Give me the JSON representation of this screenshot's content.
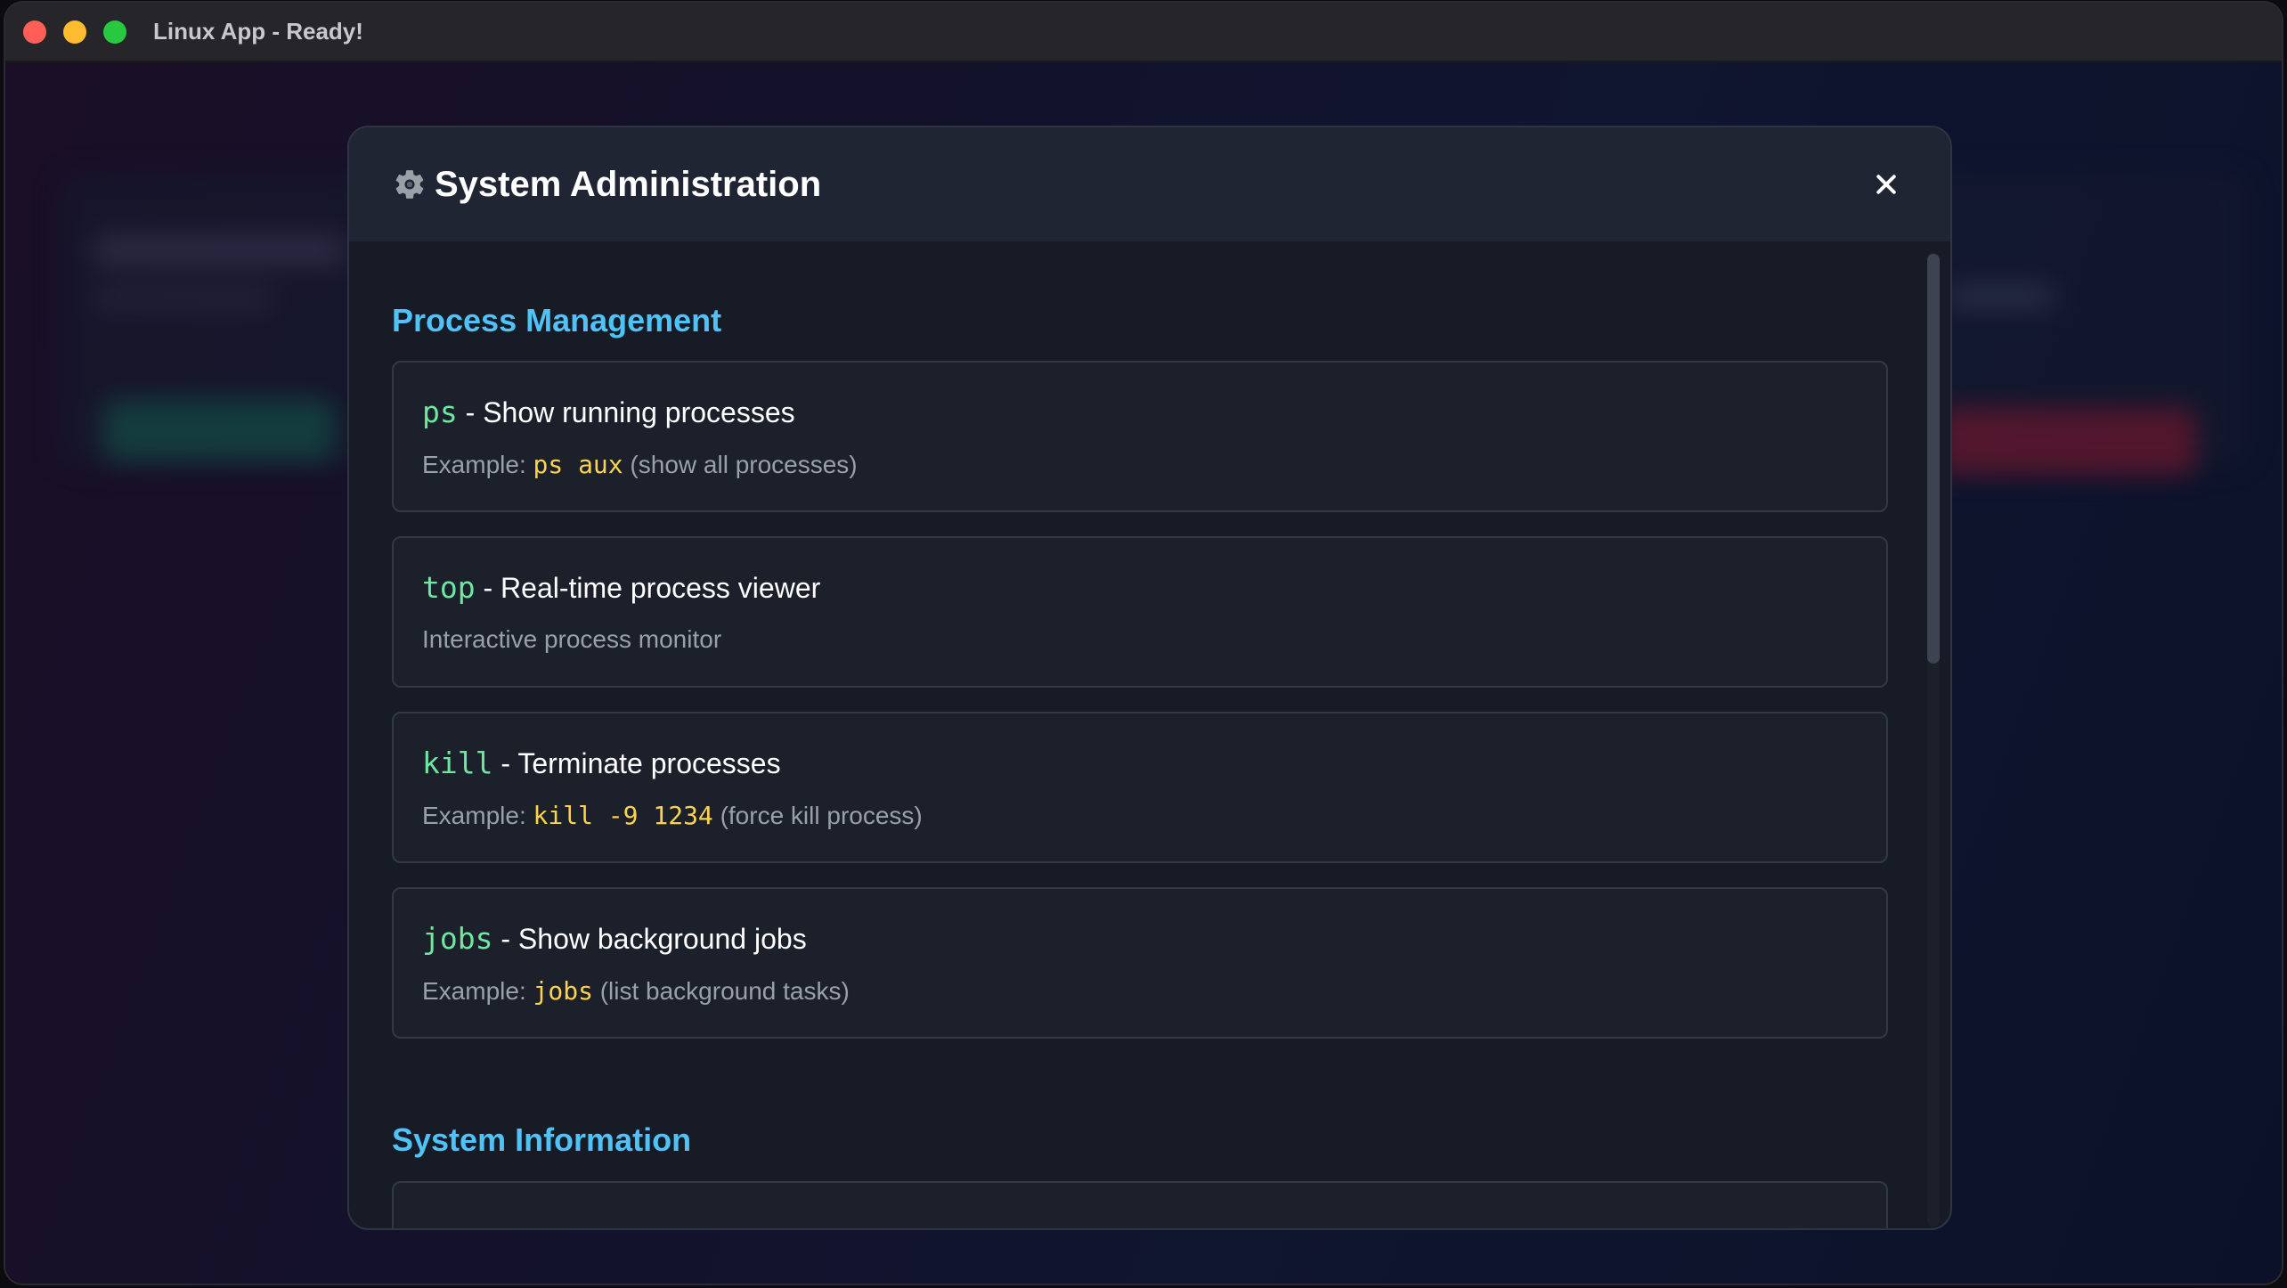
{
  "window": {
    "title": "Linux App - Ready!"
  },
  "modal": {
    "icon": "gear-icon",
    "title": "System Administration",
    "close_icon": "close-icon"
  },
  "sections": [
    {
      "title": "Process Management",
      "commands": [
        {
          "name": "ps",
          "separator": " - ",
          "description": "Show running processes",
          "example_prefix": "Example: ",
          "example_code": "ps aux",
          "example_suffix": " (show all processes)"
        },
        {
          "name": "top",
          "separator": " - ",
          "description": "Real-time process viewer",
          "note": "Interactive process monitor"
        },
        {
          "name": "kill",
          "separator": " - ",
          "description": "Terminate processes",
          "example_prefix": "Example: ",
          "example_code": "kill -9 1234",
          "example_suffix": " (force kill process)"
        },
        {
          "name": "jobs",
          "separator": " - ",
          "description": "Show background jobs",
          "example_prefix": "Example: ",
          "example_code": "jobs",
          "example_suffix": " (list background tasks)"
        }
      ]
    },
    {
      "title": "System Information",
      "commands": []
    }
  ],
  "colors": {
    "section_title": "#4fc3f7",
    "command_name": "#6ee7a0",
    "example_code": "#fbd34d",
    "traffic_red": "#ff5f57",
    "traffic_yellow": "#febc2e",
    "traffic_green": "#28c840"
  }
}
